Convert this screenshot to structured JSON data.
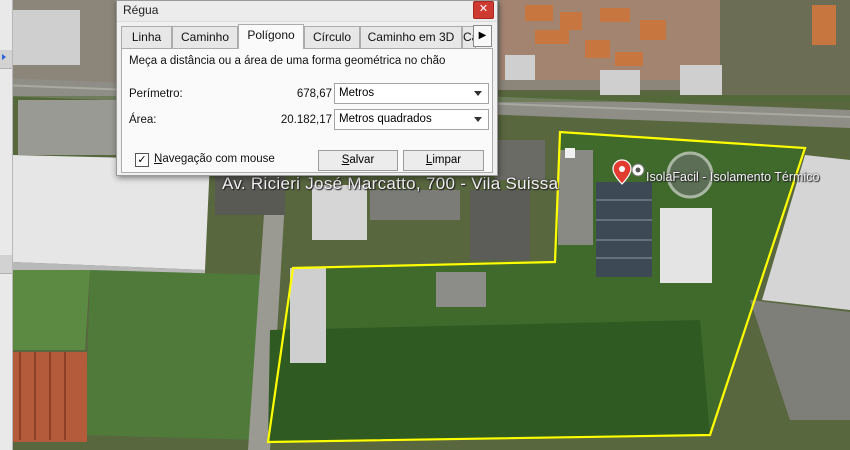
{
  "dialog": {
    "title": "Régua",
    "close_label": "✕",
    "tabs": [
      {
        "label": "Linha",
        "active": false
      },
      {
        "label": "Caminho",
        "active": false
      },
      {
        "label": "Polígono",
        "active": true
      },
      {
        "label": "Círculo",
        "active": false
      },
      {
        "label": "Caminho em 3D",
        "active": false
      },
      {
        "label": "Ca",
        "active": false
      }
    ],
    "tab_scroll_icon": "▶",
    "description": "Meça a distância ou a área de uma forma geométrica no chão",
    "perimeter": {
      "label": "Perímetro:",
      "value": "678,67",
      "unit": "Metros"
    },
    "area": {
      "label": "Área:",
      "value": "20.182,17",
      "unit": "Metros quadrados"
    },
    "mouse_nav": {
      "checked": true,
      "check_glyph": "✓",
      "label_pre": "N",
      "label_rest": "avegação com mouse"
    },
    "save_button": {
      "pre": "",
      "ul": "S",
      "rest": "alvar"
    },
    "clear_button": {
      "pre": "",
      "ul": "L",
      "rest": "impar"
    }
  },
  "map": {
    "street_label": "Av. Ricieri José Marcatto, 700 - Vila Suissa",
    "place_label": "IsolaFacil - Isolamento Térmico",
    "colors": {
      "polygon": "#ffff00",
      "pin": "#e23b30",
      "road": "#8a8a8a"
    }
  }
}
